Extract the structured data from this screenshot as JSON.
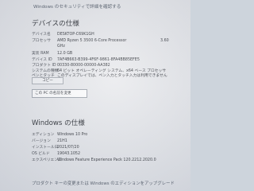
{
  "top_link": "Windows のセキュリティで詳細を確認する",
  "device_specs": {
    "title": "デバイスの仕様",
    "rows": [
      {
        "label": "デバイス名",
        "value": "DESKTOP-C69K1GH",
        "extra": ""
      },
      {
        "label": "プロセッサ",
        "value": "AMD Ryzen 5 3500 6-Core Processor",
        "extra": "3.60"
      },
      {
        "label": "",
        "value": "GHz",
        "extra": ""
      },
      {
        "label": "実装 RAM",
        "value": "12.0 GB",
        "extra": ""
      },
      {
        "label": "デバイス ID",
        "value": "7AF4B663-B399-4F6F-9861-8FA4BB85EFE5",
        "extra": ""
      },
      {
        "label": "プロダクト ID",
        "value": "00330-80000-00000-AA382",
        "extra": ""
      },
      {
        "label": "システムの種類",
        "value": "64 ビット オペレーティング システム、x64 ベース プロセッサ",
        "extra": ""
      },
      {
        "label": "ペンとタッチ",
        "value": "このディスプレイでは、ペン入力とタッチ入力は利用できません",
        "extra": ""
      }
    ],
    "copy_button": "コピー"
  },
  "rename_link": "この PC の名前を変更",
  "windows_specs": {
    "title": "Windows の仕様",
    "rows": [
      {
        "label": "エディション",
        "value": "Windows 10 Pro"
      },
      {
        "label": "バージョン",
        "value": "21H1"
      },
      {
        "label": "インストール日",
        "value": "2021/07/20"
      },
      {
        "label": "OS ビルド",
        "value": "19043.1052"
      },
      {
        "label": "エクスペリエンス",
        "value": "Windows Feature Experience Pack 120.2212.2020.0"
      }
    ]
  },
  "bottom_link": "プロダクト キーの変更または Windows のエディションをアップグレード"
}
